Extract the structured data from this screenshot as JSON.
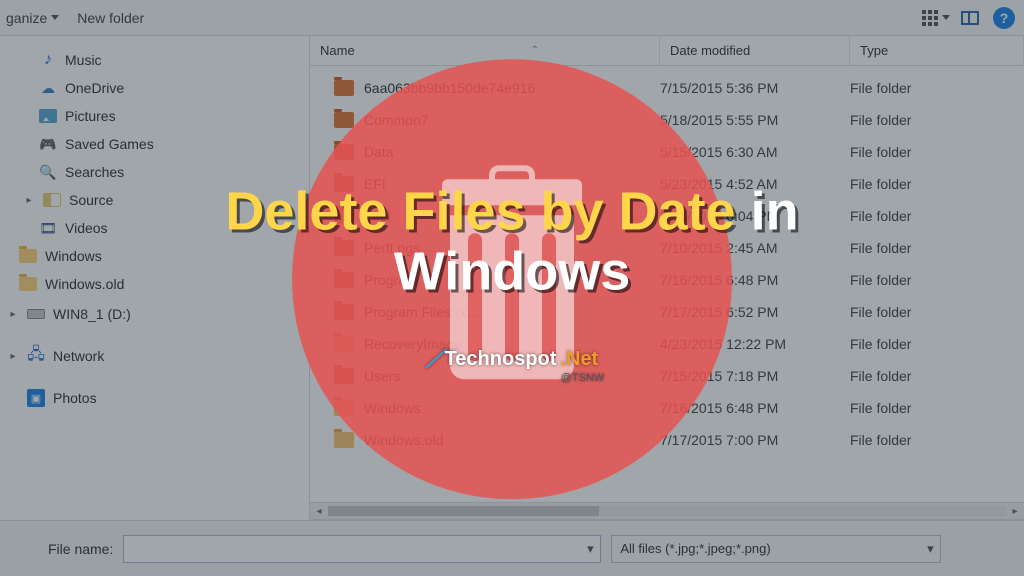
{
  "toolbar": {
    "organize_label": "ganize",
    "new_folder_label": "New folder"
  },
  "sidebar": {
    "items": [
      {
        "label": "Music",
        "icon": "music"
      },
      {
        "label": "OneDrive",
        "icon": "cloud"
      },
      {
        "label": "Pictures",
        "icon": "picture"
      },
      {
        "label": "Saved Games",
        "icon": "controller"
      },
      {
        "label": "Searches",
        "icon": "magnifier"
      },
      {
        "label": "Source",
        "icon": "source",
        "expandable": true
      },
      {
        "label": "Videos",
        "icon": "film"
      }
    ],
    "items_lvl0": [
      {
        "label": "Windows",
        "icon": "folder"
      },
      {
        "label": "Windows.old",
        "icon": "folder"
      }
    ],
    "drive": {
      "label": "WIN8_1 (D:)"
    },
    "network": {
      "label": "Network"
    },
    "photos": {
      "label": "Photos"
    }
  },
  "list": {
    "header_name": "Name",
    "header_date": "Date modified",
    "header_type": "Type",
    "rows": [
      {
        "name": "6aa063bb9bb150de74e916",
        "date": "7/15/2015 5:36 PM",
        "type": "File folder",
        "hl": true
      },
      {
        "name": "Common7",
        "date": "5/18/2015 5:55 PM",
        "type": "File folder",
        "hl": true
      },
      {
        "name": "Data",
        "date": "5/15/2015 6:30 AM",
        "type": "File folder",
        "hl": true
      },
      {
        "name": "EFI",
        "date": "5/23/2015 4:52 AM",
        "type": "File folder",
        "hl": true
      },
      {
        "name": "Intel",
        "date": "5/15/2015 6:04 PM",
        "type": "File folder",
        "hl": true
      },
      {
        "name": "PerfLogs",
        "date": "7/10/2015 2:45 AM",
        "type": "File folder",
        "hl": true
      },
      {
        "name": "Program…",
        "date": "7/16/2015 6:48 PM",
        "type": "File folder",
        "hl": true
      },
      {
        "name": "Program Files (x…",
        "date": "7/17/2015 6:52 PM",
        "type": "File folder",
        "hl": true
      },
      {
        "name": "RecoveryImage",
        "date": "4/23/2015 12:22 PM",
        "type": "File folder",
        "hl": false
      },
      {
        "name": "Users",
        "date": "7/15/2015 7:18 PM",
        "type": "File folder",
        "hl": true
      },
      {
        "name": "Windows",
        "date": "7/16/2015 6:48 PM",
        "type": "File folder",
        "hl": false
      },
      {
        "name": "Windows.old",
        "date": "7/17/2015 7:00 PM",
        "type": "File folder",
        "hl": false
      }
    ]
  },
  "bottom": {
    "filename_label": "File name:",
    "filename_value": "",
    "filter_label": "All files (*.jpg;*.jpeg;*.png)"
  },
  "overlay": {
    "title_yellow": "Delete Files by Date",
    "title_white_1": "in",
    "title_white_2": "Windows",
    "logo_main": "Technospot",
    "logo_tld": ".Net",
    "logo_handle": "@TSNW"
  }
}
